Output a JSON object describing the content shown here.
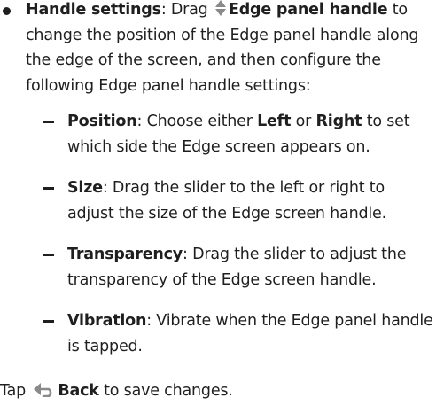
{
  "main_item": {
    "heading": "Handle settings",
    "intro": ": Drag ",
    "handle_icon": "up-down-arrows-icon",
    "handle_label": "Edge panel handle",
    "description": " to change the position of the Edge panel handle along the edge of the screen, and then configure the following Edge panel handle settings:"
  },
  "sub_items": [
    {
      "term": "Position",
      "p1": ": Choose either ",
      "left": "Left",
      "p2": " or ",
      "right": "Right",
      "p3": " to set which side the Edge screen appears on."
    },
    {
      "term": "Size",
      "text": ": Drag the slider to the left or right to adjust the size of the Edge screen handle."
    },
    {
      "term": "Transparency",
      "text": ": Drag the slider to adjust the transparency of the Edge screen handle."
    },
    {
      "term": "Vibration",
      "text": ": Vibrate when the Edge panel handle is tapped."
    }
  ],
  "footer": {
    "prefix": "Tap ",
    "back_icon": "back-arrow-icon",
    "back_label": "Back",
    "suffix": " to save changes."
  },
  "colors": {
    "text": "#1f1f1f",
    "icon": "#8a8a8a"
  }
}
